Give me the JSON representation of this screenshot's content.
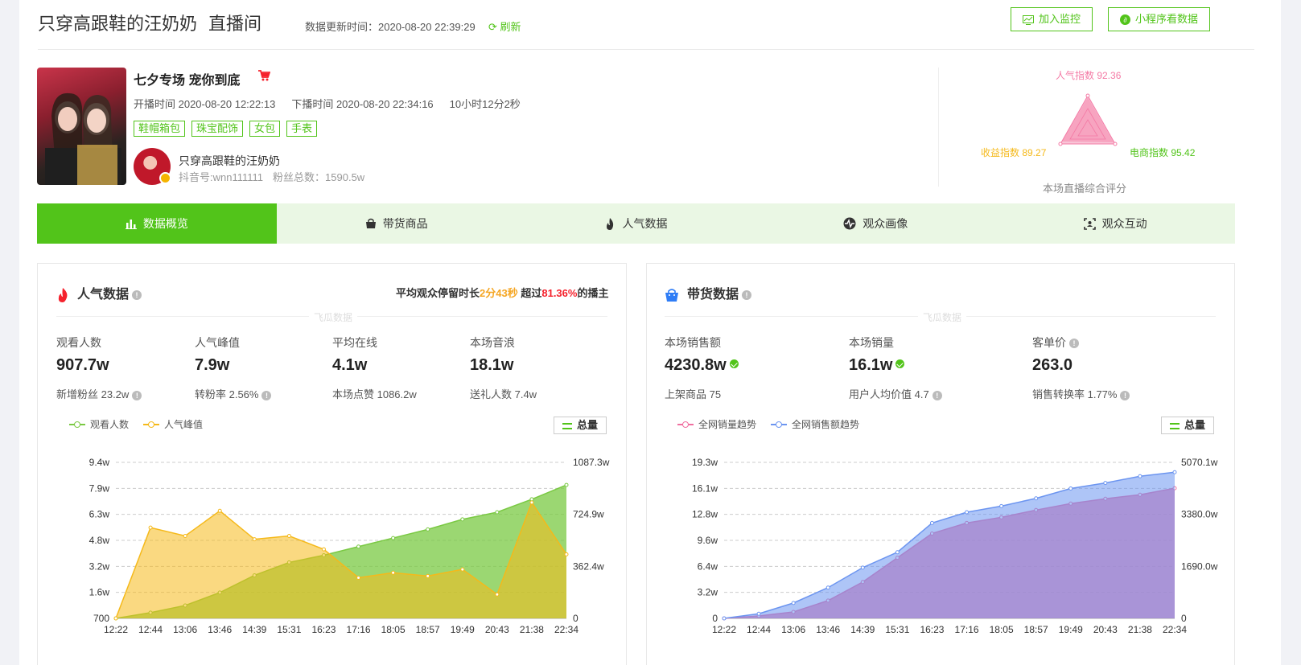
{
  "header": {
    "host_name": "只穿高跟鞋的汪奶奶",
    "room_label": "直播间",
    "update_time_label": "数据更新时间：2020-08-20 22:39:29",
    "refresh_label": "刷新",
    "monitor_button": "加入监控",
    "miniapp_button": "小程序看数据",
    "colors": {
      "accent": "#52c41a"
    }
  },
  "live": {
    "title": "七夕专场 宠你到底",
    "start_time": "开播时间 2020-08-20 12:22:13",
    "end_time": "下播时间 2020-08-20 22:34:16",
    "duration": "10小时12分2秒",
    "tags": [
      "鞋帽箱包",
      "珠宝配饰",
      "女包",
      "手表"
    ],
    "host": {
      "name": "只穿高跟鞋的汪奶奶",
      "douyin_id": "抖音号:wnn111111",
      "fans": "粉丝总数：1590.5w"
    }
  },
  "score": {
    "popularity": "人气指数 92.36",
    "income": "收益指数 89.27",
    "ecommerce": "电商指数 95.42",
    "title": "本场直播综合评分",
    "colors": {
      "popularity": "#f47aa5",
      "income": "#f5b91a",
      "ecommerce": "#52c41a"
    }
  },
  "tabs": [
    {
      "label": "数据概览",
      "icon": "bar-chart-icon",
      "active": true
    },
    {
      "label": "带货商品",
      "icon": "shopping-bag-icon",
      "active": false
    },
    {
      "label": "人气数据",
      "icon": "flame-icon",
      "active": false
    },
    {
      "label": "观众画像",
      "icon": "pulse-icon",
      "active": false
    },
    {
      "label": "观众互动",
      "icon": "focus-icon",
      "active": false
    }
  ],
  "popularity_panel": {
    "title": "人气数据",
    "dwell": {
      "prefix": "平均观众停留时长",
      "duration": "2分43秒",
      "middle": "超过",
      "percent": "81.36%",
      "suffix": "的播主"
    },
    "watermark": "飞瓜数据",
    "metrics": [
      {
        "label": "观看人数",
        "value": "907.7w",
        "sub": "新增粉丝 23.2w"
      },
      {
        "label": "人气峰值",
        "value": "7.9w",
        "sub": "转粉率 2.56%"
      },
      {
        "label": "平均在线",
        "value": "4.1w",
        "sub": "本场点赞 1086.2w"
      },
      {
        "label": "本场音浪",
        "value": "18.1w",
        "sub": "送礼人数 7.4w"
      }
    ],
    "total_button": "总量"
  },
  "sales_panel": {
    "title": "带货数据",
    "watermark": "飞瓜数据",
    "metrics": [
      {
        "label": "本场销售额",
        "value": "4230.8w",
        "sub": "上架商品 75"
      },
      {
        "label": "本场销量",
        "value": "16.1w",
        "sub": "用户人均价值 4.7"
      },
      {
        "label": "客单价",
        "value": "263.0",
        "sub": "销售转换率 1.77%"
      }
    ],
    "total_button": "总量"
  },
  "chart_data": [
    {
      "type": "area",
      "x": [
        "12:22",
        "12:44",
        "13:06",
        "13:46",
        "14:39",
        "15:31",
        "16:23",
        "17:16",
        "18:05",
        "18:57",
        "19:49",
        "20:43",
        "21:38",
        "22:34"
      ],
      "series": [
        {
          "name": "观看人数",
          "axis": "right",
          "color": "#7ac943",
          "values": [
            0,
            40,
            90,
            180,
            300,
            390,
            440,
            500,
            560,
            620,
            690,
            740,
            830,
            930
          ]
        },
        {
          "name": "人气峰值",
          "axis": "left",
          "color": "#f5b91a",
          "values": [
            0.07,
            5.5,
            5.0,
            6.5,
            4.8,
            5.0,
            4.2,
            2.5,
            2.8,
            2.6,
            3.0,
            1.5,
            7.0,
            3.9
          ]
        }
      ],
      "yleft_ticks": [
        "700",
        "1.6w",
        "3.2w",
        "4.8w",
        "6.3w",
        "7.9w",
        "9.4w"
      ],
      "yleft_range": [
        0.07,
        9.4
      ],
      "yright_ticks": [
        "0",
        "362.4w",
        "724.9w",
        "1087.3w"
      ],
      "yright_range": [
        0,
        1087.3
      ]
    },
    {
      "type": "area",
      "x": [
        "12:22",
        "12:44",
        "13:06",
        "13:46",
        "14:39",
        "15:31",
        "16:23",
        "17:16",
        "18:05",
        "18:57",
        "19:49",
        "20:43",
        "21:38",
        "22:34"
      ],
      "series": [
        {
          "name": "全网销量趋势",
          "axis": "left",
          "color": "#f06fa0",
          "values": [
            0,
            0.3,
            0.8,
            2.2,
            4.5,
            7.5,
            10.5,
            11.8,
            12.5,
            13.4,
            14.2,
            14.8,
            15.3,
            16.1
          ]
        },
        {
          "name": "全网销售额趋势",
          "axis": "right",
          "color": "#6c95f0",
          "values": [
            0,
            150,
            500,
            1000,
            1650,
            2150,
            3100,
            3450,
            3650,
            3900,
            4220,
            4400,
            4620,
            4750
          ]
        }
      ],
      "yleft_ticks": [
        "0",
        "3.2w",
        "6.4w",
        "9.6w",
        "12.8w",
        "16.1w",
        "19.3w"
      ],
      "yleft_range": [
        0,
        19.3
      ],
      "yright_ticks": [
        "0",
        "1690.0w",
        "3380.0w",
        "5070.1w"
      ],
      "yright_range": [
        0,
        5070.1
      ]
    }
  ]
}
